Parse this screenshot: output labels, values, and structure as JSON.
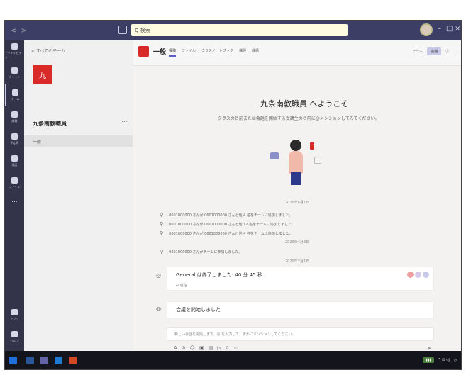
{
  "titlebar": {
    "search_placeholder": "Q 検索"
  },
  "rail": {
    "items": [
      {
        "label": "アクティビティ",
        "icon": "bell-icon"
      },
      {
        "label": "チャット",
        "icon": "chat-icon"
      },
      {
        "label": "チーム",
        "icon": "teams-icon"
      },
      {
        "label": "課題",
        "icon": "assignments-icon"
      },
      {
        "label": "予定表",
        "icon": "calendar-icon"
      },
      {
        "label": "通話",
        "icon": "phone-icon"
      },
      {
        "label": "ファイル",
        "icon": "file-icon"
      }
    ],
    "more": "...",
    "bottom": [
      {
        "label": "アプリ",
        "icon": "apps-icon"
      },
      {
        "label": "ヘルプ",
        "icon": "help-icon"
      }
    ]
  },
  "team_panel": {
    "back": "< すべてのチーム",
    "avatar_letter": "九",
    "team_name": "九条南教職員",
    "more": "...",
    "channel": "一般"
  },
  "header": {
    "channel_name": "一般",
    "tabs": [
      "投稿",
      "ファイル",
      "クラスノートブック",
      "課題",
      "成績"
    ],
    "team_label": "チーム",
    "meet_label": "会議",
    "more": "..."
  },
  "welcome": {
    "title": "九条南教職員 へようこそ",
    "subtitle": "クラスの名前または会話を開始する受講生の名前に@メンションしてみてください。"
  },
  "log": {
    "dates": [
      "2020年4月1日",
      "2020年4月3日",
      "2020年7月1日"
    ],
    "lines": [
      "0601000000 さんが 0601000000 さんと他 4 名をチームに追加しました。",
      "0601000000 さんが 0601000000 さんと他 12 名をチームに追加しました。",
      "0601000000 さんが 0601000000 さんと他 4 名をチームに追加しました。",
      "0601000000 さんがチームに参加しました。"
    ]
  },
  "posts": [
    {
      "title": "General は終了しました: 40 分 45 秒",
      "reply": "↩ 返信"
    },
    {
      "title": "会議を開始しました",
      "reply": ""
    }
  ],
  "composer": {
    "placeholder": "新しい会話を開始します。@ を入力して、誰かにメンションしてください。"
  },
  "colors": {
    "rail": "#33344a",
    "titlebar": "#3d3e66",
    "accent": "#5b5fc7",
    "team_red": "#d92a2a"
  }
}
